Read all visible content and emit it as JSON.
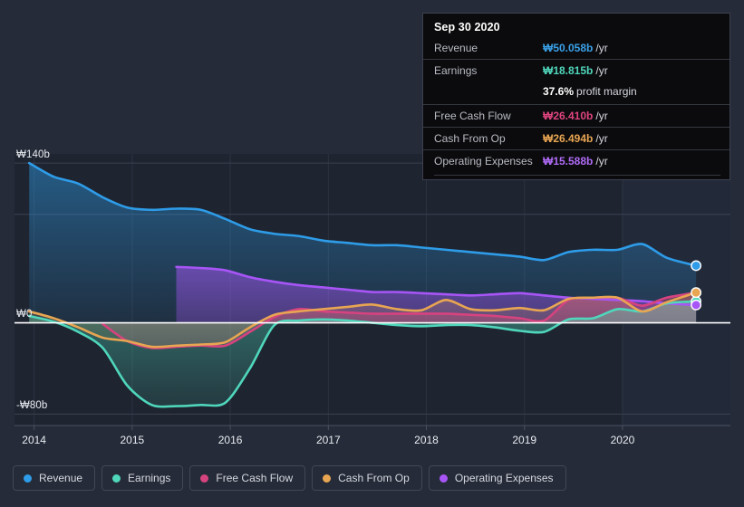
{
  "theme": {
    "background": "#252b38",
    "plot_band_dark": "#1e2430",
    "zero_line": "#ffffff",
    "grid": "#3b4150",
    "text": "#e9ecf2"
  },
  "tooltip": {
    "date": "Sep 30 2020",
    "rows": [
      {
        "label": "Revenue",
        "value": "₩50.058b",
        "unit": "/yr",
        "color": "#3aa0e8"
      },
      {
        "label": "Earnings",
        "value": "₩18.815b",
        "unit": "/yr",
        "color": "#4fd6bb"
      },
      {
        "label": "Free Cash Flow",
        "value": "₩26.410b",
        "unit": "/yr",
        "color": "#e0447f"
      },
      {
        "label": "Cash From Op",
        "value": "₩26.494b",
        "unit": "/yr",
        "color": "#e8a552"
      },
      {
        "label": "Operating Expenses",
        "value": "₩15.588b",
        "unit": "/yr",
        "color": "#a855f7"
      }
    ],
    "margin_value": "37.6%",
    "margin_label": "profit margin"
  },
  "axes": {
    "y_ticks": [
      {
        "label": "₩140b",
        "value": 140
      },
      {
        "label": "₩0",
        "value": 0
      },
      {
        "label": "-₩80b",
        "value": -80
      }
    ],
    "x_ticks": [
      "2014",
      "2015",
      "2016",
      "2017",
      "2018",
      "2019",
      "2020"
    ]
  },
  "legend": [
    {
      "label": "Revenue",
      "color": "#2e9ce8"
    },
    {
      "label": "Earnings",
      "color": "#4fd6bb"
    },
    {
      "label": "Free Cash Flow",
      "color": "#d6437f"
    },
    {
      "label": "Cash From Op",
      "color": "#e8a552"
    },
    {
      "label": "Operating Expenses",
      "color": "#a855f7"
    }
  ],
  "chart_data": {
    "type": "area",
    "title": "",
    "xlabel": "",
    "ylabel": "₩ billions",
    "ylim": [
      -90,
      148
    ],
    "xlim": [
      2013.8,
      2021.1
    ],
    "grid": true,
    "legend_position": "bottom",
    "currency": "₩",
    "units": "billions (b)",
    "x": [
      2013.95,
      2014.2,
      2014.45,
      2014.7,
      2014.95,
      2015.2,
      2015.45,
      2015.7,
      2015.95,
      2016.2,
      2016.45,
      2016.7,
      2016.95,
      2017.2,
      2017.45,
      2017.7,
      2017.95,
      2018.2,
      2018.45,
      2018.7,
      2018.95,
      2019.2,
      2019.45,
      2019.7,
      2019.95,
      2020.2,
      2020.45,
      2020.75
    ],
    "series": [
      {
        "name": "Revenue",
        "color": "#2e9ce8",
        "values": [
          140.0,
          128.0,
          122.0,
          110.0,
          101.0,
          99.0,
          100.0,
          99.0,
          91.0,
          82.0,
          78.0,
          76.0,
          72.0,
          70.0,
          68.0,
          68.0,
          66.0,
          64.0,
          62.0,
          60.0,
          58.0,
          55.0,
          62.0,
          64.0,
          64.0,
          69.0,
          57.0,
          50.058
        ]
      },
      {
        "name": "Earnings",
        "color": "#4fd6bb",
        "values": [
          6.0,
          1.0,
          -8.0,
          -22.0,
          -55.0,
          -72.0,
          -73.0,
          -72.0,
          -70.0,
          -40.0,
          -2.0,
          2.0,
          3.0,
          2.0,
          0.0,
          -2.0,
          -3.0,
          -2.0,
          -2.0,
          -4.0,
          -7.0,
          -8.0,
          3.0,
          4.0,
          12.0,
          10.0,
          17.0,
          18.815
        ]
      },
      {
        "name": "Free Cash Flow",
        "color": "#d6437f",
        "values": [
          null,
          null,
          null,
          -1.0,
          -16.0,
          -22.0,
          -21.0,
          -20.0,
          -20.0,
          -8.0,
          5.0,
          12.0,
          10.0,
          9.0,
          8.0,
          8.0,
          8.0,
          8.0,
          7.0,
          6.0,
          4.0,
          2.0,
          20.0,
          22.0,
          22.0,
          15.0,
          22.0,
          26.41
        ]
      },
      {
        "name": "Cash From Op",
        "color": "#e8a552",
        "values": [
          10.0,
          4.0,
          -4.0,
          -13.0,
          -16.0,
          -21.0,
          -20.0,
          -19.0,
          -17.0,
          -4.0,
          7.0,
          10.0,
          12.0,
          14.0,
          16.0,
          12.0,
          11.0,
          20.0,
          12.0,
          11.0,
          13.0,
          11.0,
          21.0,
          22.0,
          22.0,
          10.0,
          18.0,
          26.494
        ]
      },
      {
        "name": "Operating Expenses",
        "color": "#a855f7",
        "values": [
          null,
          null,
          null,
          null,
          null,
          null,
          49.0,
          48.0,
          46.0,
          40.0,
          36.0,
          33.0,
          31.0,
          29.0,
          27.0,
          27.0,
          26.0,
          25.0,
          24.0,
          25.0,
          26.0,
          24.0,
          22.0,
          21.0,
          20.0,
          19.0,
          17.0,
          15.588
        ]
      }
    ],
    "highlight_point_x": 2020.75,
    "forecast_band_start": 2020.0
  }
}
